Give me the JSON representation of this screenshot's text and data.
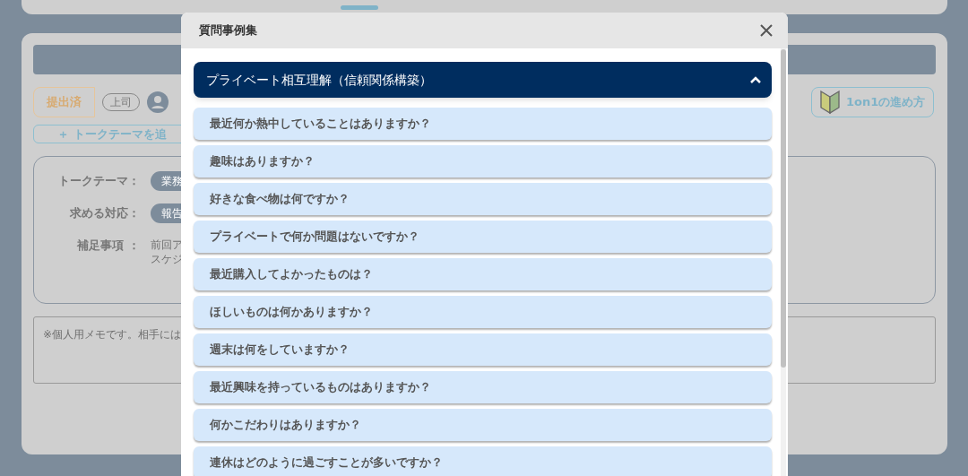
{
  "background": {
    "status_tag": "提出済",
    "role_tag": "上司",
    "add_theme_button": "＋ トークテーマを追",
    "guide_button": "1on1の進め方",
    "fields": [
      {
        "label": "トークテーマ：",
        "kind": "chip",
        "value": "業務"
      },
      {
        "label": "求める対応：",
        "kind": "chip",
        "value": "報告"
      },
      {
        "label": "補足事項 ：",
        "kind": "text",
        "lines": [
          "前回ア",
          "スケジ"
        ]
      }
    ],
    "memo": {
      "placeholder": "※個人用メモです。相手には"
    }
  },
  "modal": {
    "title": "質問事例集",
    "section": {
      "title": "プライベート相互理解（信頼関係構築）",
      "expanded": true,
      "questions": [
        "最近何か熱中していることはありますか？",
        "趣味はありますか？",
        "好きな食べ物は何ですか？",
        "プライベートで何か問題はないですか？",
        "最近購入してよかったものは？",
        "ほしいものは何かありますか？",
        "週末は何をしていますか？",
        "最近興味を持っているものはありますか？",
        "何かこだわりはありますか？",
        "連休はどのように過ごすことが多いですか？"
      ]
    }
  }
}
